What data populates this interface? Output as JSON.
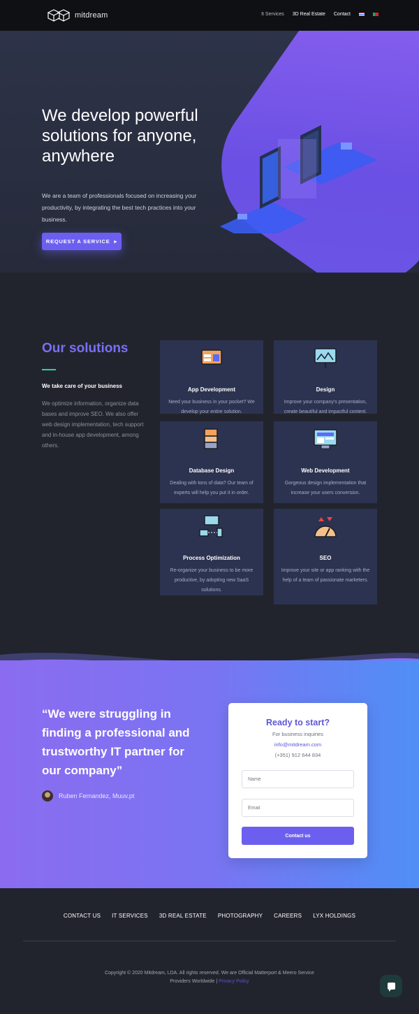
{
  "header": {
    "logo_text": "mitdream",
    "nav": [
      "It Services",
      "3D Real Estate",
      "Contact"
    ],
    "flags": [
      "flag-en-icon",
      "flag-pt-icon"
    ]
  },
  "hero": {
    "title": "We develop powerful solutions for anyone, anywhere",
    "subtitle": "We are a team of professionals focused on increasing your productivity, by integrating the best tech practices into your business.",
    "cta_label": "REQUEST A SERVICE",
    "cta_icon": "caret-right-icon"
  },
  "solutions": {
    "heading": "Our solutions",
    "tagline": "We take care of your business",
    "description": "We optimize information, organize data bases and improve SEO. We also offer web design implementation, tech support and in-house app development, among others.",
    "cards": [
      {
        "icon": "app-development-icon",
        "title": "App Development",
        "text": "Need your business in your pocket? We develop your entire solution."
      },
      {
        "icon": "design-icon",
        "title": "Design",
        "text": "Improve your company's presentation, create beautiful and impactful content."
      },
      {
        "icon": "database-icon",
        "title": "Database Design",
        "text": "Dealing with tons of data? Our team of experts will help you put it in order."
      },
      {
        "icon": "web-development-icon",
        "title": "Web Development",
        "text": "Gorgeous design implementation that increase your users conversion."
      },
      {
        "icon": "process-optimization-icon",
        "title": "Process Optimization",
        "text": "Re-organize your business to be more productive, by adopting new SaaS solutions."
      },
      {
        "icon": "seo-icon",
        "title": "SEO",
        "text": "Improve your site or app ranking with the help of a team of passionate marketers."
      }
    ]
  },
  "testimonial": {
    "quote": "“We were struggling in finding a professional and trustworthy IT partner for our company”",
    "author": "Ruben Fernandez, Muuv.pt"
  },
  "contact_card": {
    "title": "Ready to start?",
    "subtitle": "For business inquiries",
    "email": "info@mitdream.com",
    "phone": "(+351) 912 644 834",
    "name_placeholder": "Name",
    "email_placeholder": "Email",
    "button_label": "Contact us"
  },
  "footer": {
    "links": [
      "CONTACT US",
      "IT SERVICES",
      "3D REAL ESTATE",
      "PHOTOGRAPHY",
      "CAREERS",
      "LYX HOLDINGS"
    ],
    "copyright": "Copyright © 2020 Mitdream, LDA. All rights reserved. We are Official Matterport & Meero Service Providers Worldwide |",
    "privacy_label": "Privacy Policy",
    "chat_icon": "chat-bubble-icon"
  },
  "colors": {
    "accent": "#6c5ff0",
    "heading_purple": "#7a6ff5",
    "teal_rule": "#27d1b5",
    "card_bg": "#2c3350",
    "page_bg": "#22242d"
  }
}
